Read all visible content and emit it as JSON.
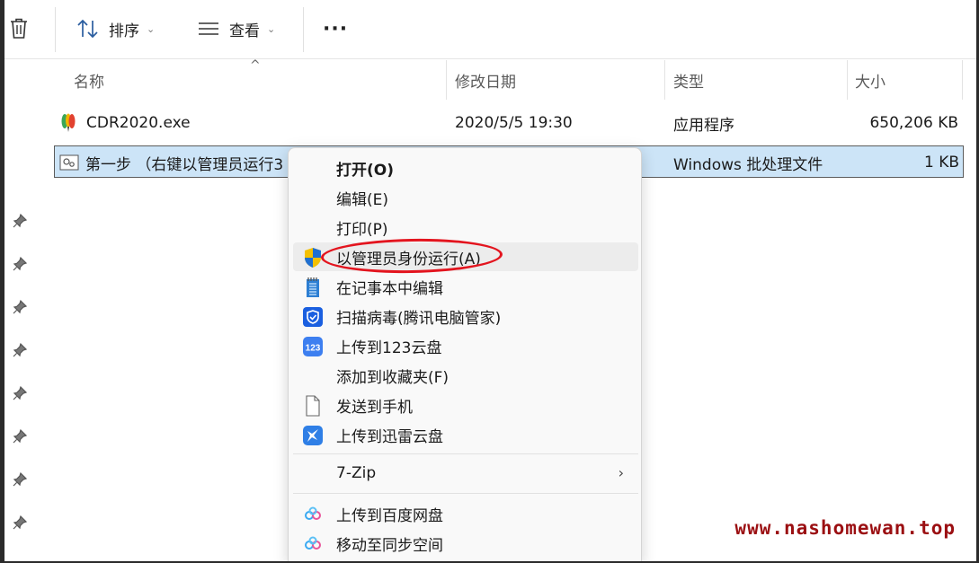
{
  "toolbar": {
    "sort_label": "排序",
    "view_label": "查看",
    "more_label": "···"
  },
  "columns": {
    "name": "名称",
    "modified": "修改日期",
    "type": "类型",
    "size": "大小"
  },
  "files": [
    {
      "name": "CDR2020.exe",
      "modified": "2020/5/5 19:30",
      "type": "应用程序",
      "size": "650,206 KB",
      "icon": "coreldraw-icon"
    },
    {
      "name": "第一步 （右键以管理员运行3",
      "modified": "",
      "type": "Windows 批处理文件",
      "size": "1 KB",
      "icon": "batch-file-icon",
      "selected": true
    }
  ],
  "context_menu": {
    "items": [
      {
        "label": "打开(O)",
        "icon": "",
        "bold": true
      },
      {
        "label": "编辑(E)",
        "icon": ""
      },
      {
        "label": "打印(P)",
        "icon": ""
      },
      {
        "label": "以管理员身份运行(A)",
        "icon": "uac-shield-icon",
        "highlighted": true
      },
      {
        "label": "在记事本中编辑",
        "icon": "notepad-icon"
      },
      {
        "label": "扫描病毒(腾讯电脑管家)",
        "icon": "tencent-shield-icon"
      },
      {
        "label": "上传到123云盘",
        "icon": "123pan-icon"
      },
      {
        "label": "添加到收藏夹(F)",
        "icon": ""
      },
      {
        "label": "发送到手机",
        "icon": "phone-document-icon"
      },
      {
        "label": "上传到迅雷云盘",
        "icon": "xunlei-icon"
      },
      {
        "label": "7-Zip",
        "icon": "",
        "submenu": true
      },
      {
        "label": "上传到百度网盘",
        "icon": "baidu-netdisk-icon"
      },
      {
        "label": "移动至同步空间",
        "icon": "baidu-netdisk-icon"
      }
    ]
  },
  "watermark": "www.nashomewan.top",
  "colors": {
    "selection_bg": "#cce4f7",
    "annotation_red": "#e3141e",
    "watermark": "#9b0f12",
    "menu_bg": "#f9f9f9"
  }
}
